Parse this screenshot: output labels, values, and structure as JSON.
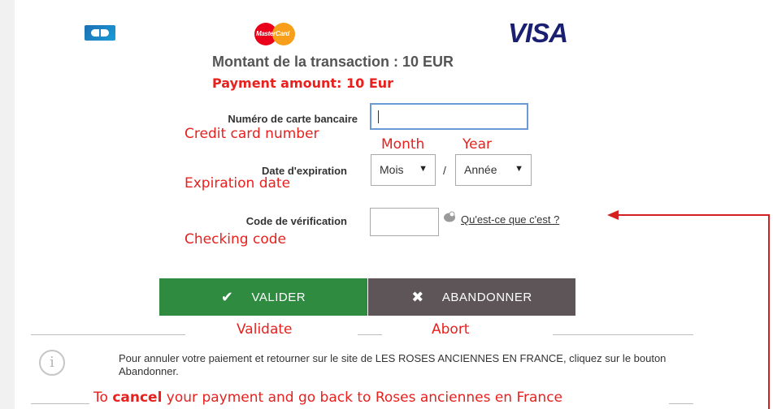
{
  "logos": {
    "cb": "CB",
    "mastercard": "MasterCard",
    "visa": "VISA"
  },
  "amount": {
    "fr": "Montant de la transaction : 10 EUR",
    "en": "Payment amount: 10 Eur"
  },
  "card": {
    "label": "Numéro de carte bancaire",
    "translation": "Credit card number",
    "value": ""
  },
  "expiry": {
    "label": "Date d'expiration",
    "translation": "Expiration date",
    "month_hint": "Month",
    "year_hint": "Year",
    "month_value": "Mois",
    "year_value": "Année",
    "separator": "/"
  },
  "code": {
    "label": "Code de vérification",
    "translation": "Checking code",
    "help_link": "Qu'est-ce que c'est ?"
  },
  "buttons": {
    "validate": "VALIDER",
    "validate_translation": "Validate",
    "abort": "ABANDONNER",
    "abort_translation": "Abort"
  },
  "info": {
    "text": "Pour annuler votre paiement et retourner sur le site de LES ROSES ANCIENNES EN FRANCE, cliquez sur le bouton Abandonner.",
    "icon_glyph": "i"
  },
  "cancel_note": {
    "prefix": "To ",
    "emphasis": "cancel",
    "suffix": " your payment and go back to Roses anciennes en France"
  },
  "colors": {
    "annotation": "#e8201e",
    "validate_button": "#2e8b3f",
    "abort_button": "#5e5558",
    "input_focus": "#6a9ad6"
  }
}
